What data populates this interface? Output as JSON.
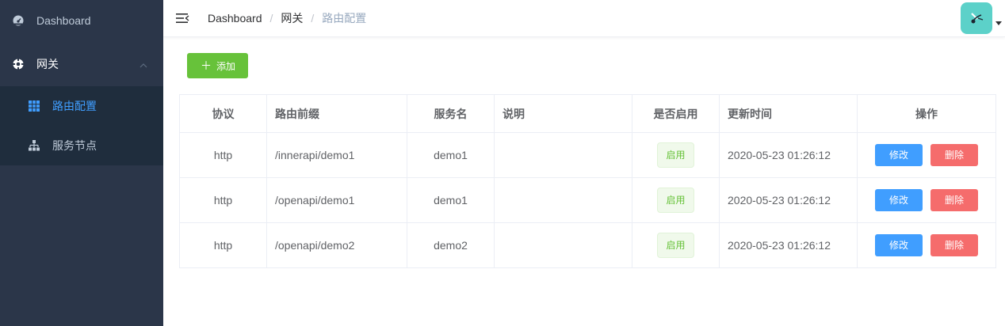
{
  "sidebar": {
    "dashboard": {
      "label": "Dashboard",
      "icon": "dashboard-icon"
    },
    "gateway": {
      "label": "网关",
      "icon": "gateway-icon",
      "expanded": true
    },
    "submenu": [
      {
        "label": "路由配置",
        "icon": "grid-icon",
        "active": true
      },
      {
        "label": "服务节点",
        "icon": "hierarchy-icon",
        "active": false
      }
    ]
  },
  "navbar": {
    "breadcrumb": [
      "Dashboard",
      "网关",
      "路由配置"
    ],
    "separator": "/"
  },
  "toolbar": {
    "add_label": "添加"
  },
  "table": {
    "headers": [
      "协议",
      "路由前缀",
      "服务名",
      "说明",
      "是否启用",
      "更新时间",
      "操作"
    ],
    "rows": [
      {
        "protocol": "http",
        "prefix": "/innerapi/demo1",
        "service": "demo1",
        "desc": "",
        "enabled": "启用",
        "updated": "2020-05-23 01:26:12",
        "edit": "修改",
        "delete": "删除"
      },
      {
        "protocol": "http",
        "prefix": "/openapi/demo1",
        "service": "demo1",
        "desc": "",
        "enabled": "启用",
        "updated": "2020-05-23 01:26:12",
        "edit": "修改",
        "delete": "删除"
      },
      {
        "protocol": "http",
        "prefix": "/openapi/demo2",
        "service": "demo2",
        "desc": "",
        "enabled": "启用",
        "updated": "2020-05-23 01:26:12",
        "edit": "修改",
        "delete": "删除"
      }
    ]
  },
  "colors": {
    "sidebar_bg": "#2b3649",
    "submenu_bg": "#1f2d3d",
    "active": "#409eff",
    "success": "#67c23a",
    "danger": "#f56c6c",
    "avatar_bg": "#5cd1c9"
  }
}
